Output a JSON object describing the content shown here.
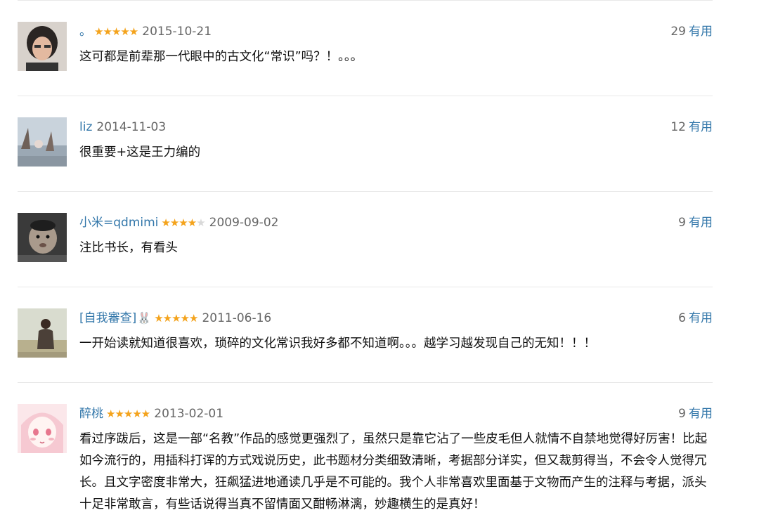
{
  "reviews": [
    {
      "user": "。",
      "rating": 5,
      "stars": "★★★★★",
      "stars_off": "",
      "date": "2015-10-21",
      "useful_count": "29",
      "useful_label": "有用",
      "content": "这可都是前辈那一代眼中的古文化“常识”吗？！。。。"
    },
    {
      "user": "liz",
      "rating": 0,
      "stars": "",
      "stars_off": "",
      "date": "2014-11-03",
      "useful_count": "12",
      "useful_label": "有用",
      "content": "很重要+这是王力编的"
    },
    {
      "user": "小米=qdmimi",
      "rating": 4,
      "stars": "★★★★",
      "stars_off": "★",
      "date": "2009-09-02",
      "useful_count": "9",
      "useful_label": "有用",
      "content": "注比书长，有看头"
    },
    {
      "user": "[自我審查]",
      "rating": 5,
      "stars": "★★★★★",
      "stars_off": "",
      "date": "2011-06-16",
      "useful_count": "6",
      "useful_label": "有用",
      "content": "一开始读就知道很喜欢，琐碎的文化常识我好多都不知道啊。。。越学习越发现自己的无知！！！"
    },
    {
      "user": "醉桃",
      "rating": 5,
      "stars": "★★★★★",
      "stars_off": "",
      "date": "2013-02-01",
      "useful_count": "9",
      "useful_label": "有用",
      "content": "看过序跋后，这是一部“名教”作品的感觉更强烈了，虽然只是靠它沾了一些皮毛但人就情不自禁地觉得好厉害！比起如今流行的，用插科打诨的方式戏说历史，此书题材分类细致清晰，考据部分详实，但又裁剪得当，不会令人觉得冗长。且文字密度非常大，狂飙猛进地通读几乎是不可能的。我个人非常喜欢里面基于文物而产生的注释与考据，派头十足非常敢言，有些话说得当真不留情面又酣畅淋漓，妙趣横生的是真好！"
    }
  ],
  "colors": {
    "link": "#3377aa",
    "star": "#f4a31c",
    "divider": "#e8e8e8",
    "muted": "#666666"
  }
}
